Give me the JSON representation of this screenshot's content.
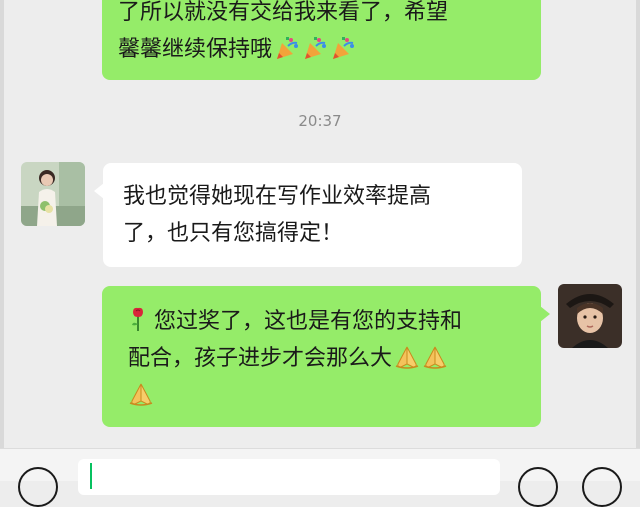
{
  "messages": [
    {
      "direction": "outgoing",
      "lines": [
        "了所以就没有交给我来看了，希望",
        "馨馨继续保持哦"
      ],
      "emoji": [
        "party-popper",
        "party-popper",
        "party-popper"
      ]
    },
    {
      "direction": "incoming",
      "lines": [
        "我也觉得她现在写作业效率提高",
        "了，也只有您搞得定！"
      ]
    },
    {
      "direction": "outgoing",
      "lines": [
        "您过奖了，这也是有您的支持和",
        "配合，孩子进步才会那么大"
      ],
      "prefix_emoji": "rose",
      "emoji": [
        "folded-hands",
        "folded-hands",
        "folded-hands"
      ]
    }
  ],
  "timestamp": "20:37",
  "input_bar": {
    "text": ""
  },
  "colors": {
    "background": "#ededed",
    "outgoing_bubble": "#95ec69",
    "incoming_bubble": "#ffffff",
    "cursor": "#07c160"
  },
  "icons": {
    "voice": "voice-icon",
    "emoji": "emoji-icon",
    "more": "plus-icon"
  }
}
